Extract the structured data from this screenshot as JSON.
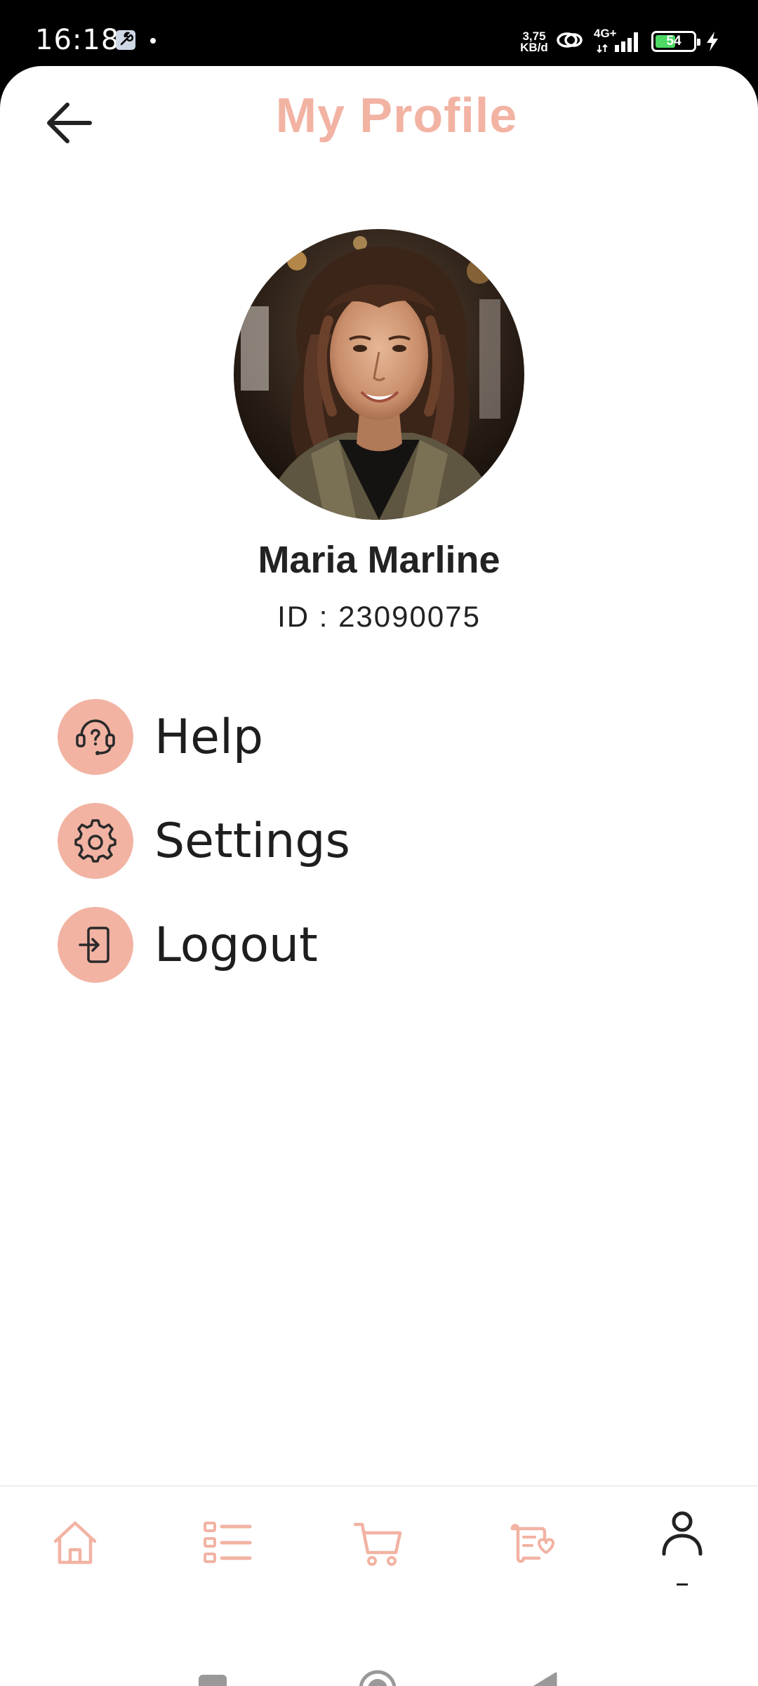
{
  "status_bar": {
    "time": "16:18",
    "net_speed_value": "3,75",
    "net_speed_unit": "KB/d",
    "network_type": "4G+",
    "battery": "54",
    "battery_level": 0.54,
    "battery_color": "#4cd964"
  },
  "header": {
    "title": "My Profile",
    "back_icon": "arrow-left-icon"
  },
  "profile": {
    "name": "Maria Marline",
    "id_text": "ID : 23090075",
    "avatar_icon": "profile-photo"
  },
  "menu": {
    "items": [
      {
        "label": "Help",
        "icon": "help-headset-icon"
      },
      {
        "label": "Settings",
        "icon": "gear-icon"
      },
      {
        "label": "Logout",
        "icon": "logout-icon"
      }
    ]
  },
  "bottom_nav": {
    "items": [
      {
        "name": "home",
        "icon": "home-icon",
        "active": false
      },
      {
        "name": "list",
        "icon": "list-icon",
        "active": false
      },
      {
        "name": "cart",
        "icon": "cart-icon",
        "active": false
      },
      {
        "name": "orders",
        "icon": "order-ticket-icon",
        "active": false
      },
      {
        "name": "profile",
        "icon": "person-icon",
        "active": true
      }
    ]
  },
  "colors": {
    "accent": "#f2b3a3",
    "text": "#222222",
    "background": "#ffffff"
  }
}
